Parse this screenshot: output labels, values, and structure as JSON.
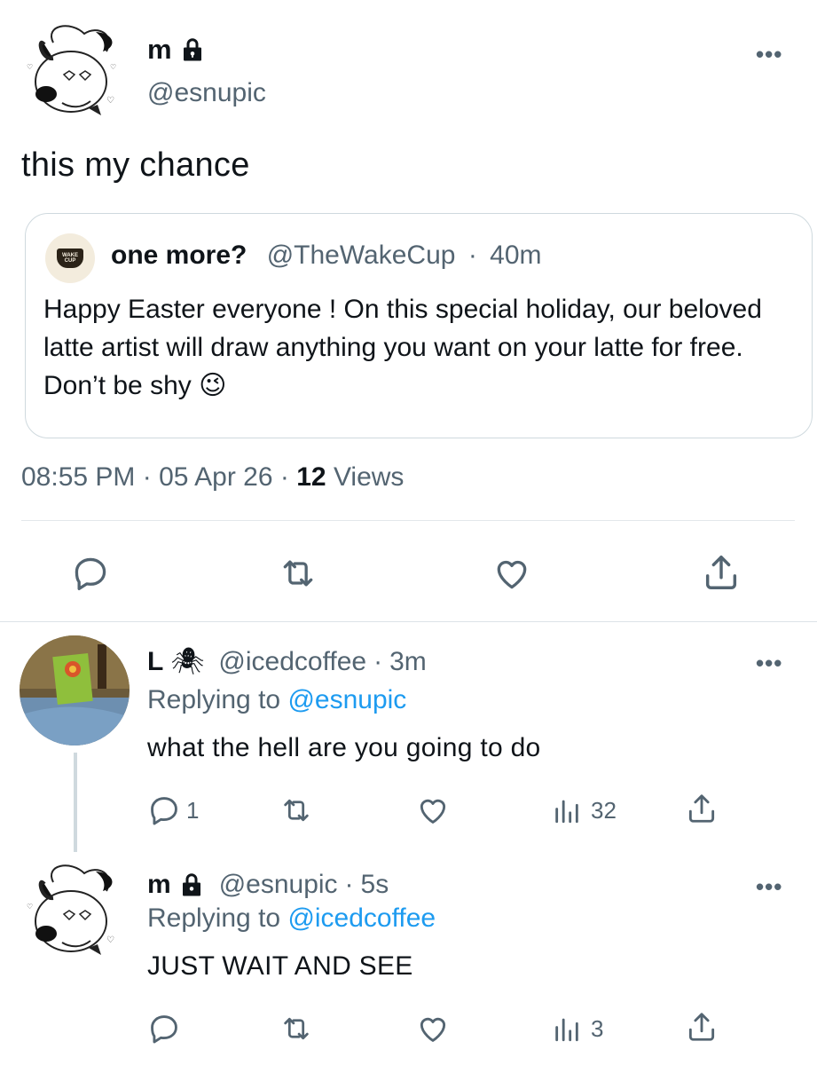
{
  "main_tweet": {
    "display_name": "m",
    "handle": "@esnupic",
    "text": "this my chance",
    "more_label": "•••",
    "quote": {
      "logo_text": "WAKE CUP",
      "display_name": "one more?",
      "handle": "@TheWakeCup",
      "separator": "·",
      "time": "40m",
      "body": "Happy Easter everyone ! On this special holiday, our beloved latte artist will draw anything you want on your latte for free. Don’t be shy 😉"
    },
    "meta": {
      "time": "08:55 PM",
      "sep1": "·",
      "date": "05 Apr 26",
      "sep2": "·",
      "views_count": "12",
      "views_label": "Views"
    }
  },
  "replies": [
    {
      "display_name": "L",
      "emoji": "🕷",
      "handle": "@icedcoffee",
      "separator": "·",
      "time": "3m",
      "replying_prefix": "Replying to",
      "replying_to": "@esnupic",
      "text": "what the hell are you going to do",
      "reply_count": "1",
      "views_count": "32",
      "more_label": "•••"
    },
    {
      "display_name": "m",
      "handle": "@esnupic",
      "separator": "·",
      "time": "5s",
      "replying_prefix": "Replying to",
      "replying_to": "@icedcoffee",
      "text": "JUST WAIT AND SEE",
      "views_count": "3",
      "more_label": "•••"
    }
  ],
  "colors": {
    "link": "#1d9bf0",
    "secondary_text": "#536471",
    "border": "#cfd9de"
  }
}
